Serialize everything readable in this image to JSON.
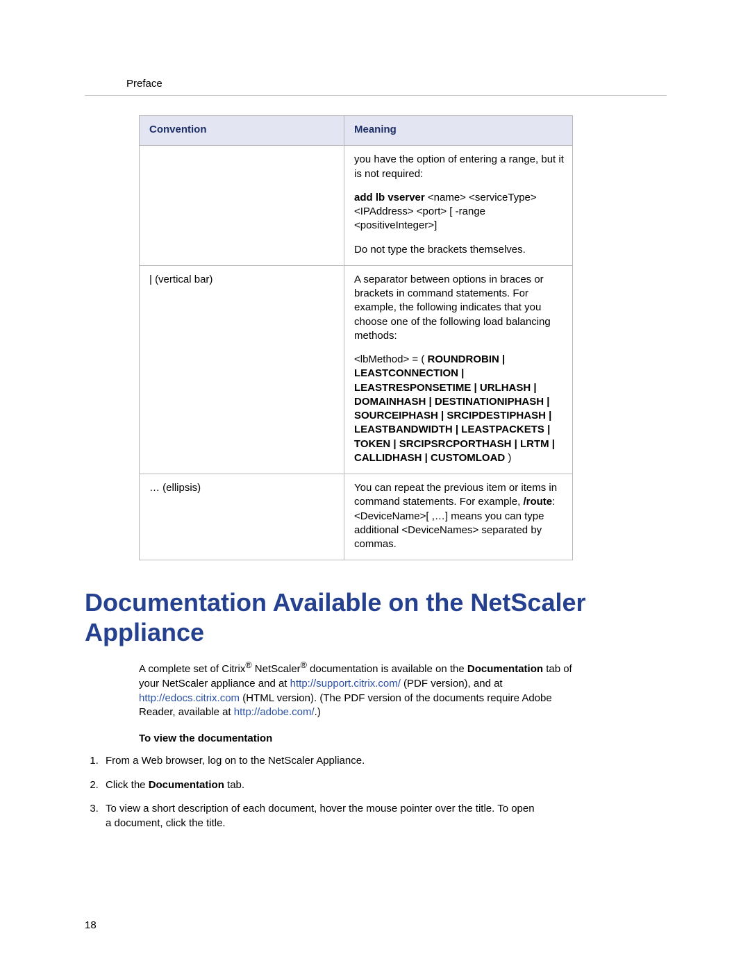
{
  "section_label": "Preface",
  "table": {
    "headers": {
      "convention": "Convention",
      "meaning": "Meaning"
    },
    "rows": [
      {
        "convention": "",
        "meaning": {
          "p1": "you have the option of entering a range, but it is not required:",
          "p2_bold": "add lb vserver",
          "p2_rest": " <name> <serviceType> <IPAddress> <port> [ -range <positiveInteger>]",
          "p3": "Do not type the brackets themselves."
        }
      },
      {
        "convention": "| (vertical bar)",
        "meaning": {
          "p1": "A separator between options in braces or brackets in command statements. For example, the following indicates that you choose one of the following load balancing methods:",
          "p2_lead": "<lbMethod> = ( ",
          "p2_bold": "ROUNDROBIN | LEASTCONNECTION | LEASTRESPONSETIME | URLHASH | DOMAINHASH | DESTINATIONIPHASH | SOURCEIPHASH | SRCIPDESTIPHASH | LEASTBANDWIDTH | LEASTPACKETS | TOKEN | SRCIPSRCPORTHASH | LRTM | CALLIDHASH | CUSTOMLOAD",
          "p2_trail": " )"
        }
      },
      {
        "convention": "… (ellipsis)",
        "meaning": {
          "p1a": "You can repeat the previous item or items in command statements. For example, ",
          "p1_bold": "/route",
          "p1b": ":<DeviceName>[ ,…] means you can type additional <DeviceNames> separated by commas."
        }
      }
    ]
  },
  "heading": "Documentation Available on the NetScaler Appliance",
  "intro": {
    "t1": "A complete set of Citrix",
    "reg1": "®",
    "t2": " NetScaler",
    "reg2": "®",
    "t3": " documentation is available on the ",
    "bold1": "Documentation",
    "t4": " tab of your NetScaler appliance and at ",
    "link1": "http://support.citrix.com/",
    "t5": " (PDF version), and at ",
    "link2": "http://edocs.citrix.com",
    "t6": " (HTML version). (The PDF version of the documents require Adobe Reader, available at ",
    "link3": "http://adobe.com/",
    "t7": ".)"
  },
  "subheading": "To view the documentation",
  "steps": {
    "s1": "From a Web browser, log on to the NetScaler Appliance.",
    "s2a": "Click the ",
    "s2b": "Documentation",
    "s2c": " tab.",
    "s3": "To view a short description of each document, hover the mouse pointer over the title. To open a document, click the title."
  },
  "page_number": "18"
}
